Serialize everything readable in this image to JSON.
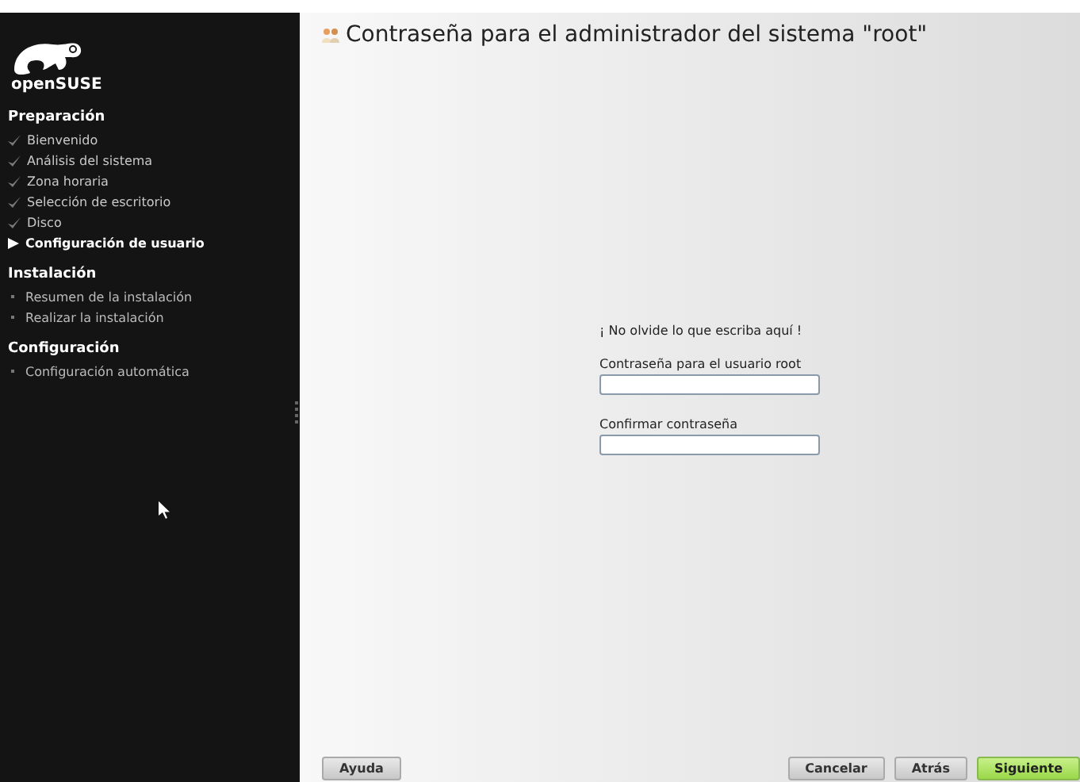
{
  "sidebar": {
    "logo_text": "openSUSE",
    "sections": [
      {
        "title": "Preparación",
        "items": [
          {
            "label": "Bienvenido",
            "kind": "done"
          },
          {
            "label": "Análisis del sistema",
            "kind": "done"
          },
          {
            "label": "Zona horaria",
            "kind": "done"
          },
          {
            "label": "Selección de escritorio",
            "kind": "done"
          },
          {
            "label": "Disco",
            "kind": "done"
          },
          {
            "label": "Configuración de usuario",
            "kind": "current"
          }
        ]
      },
      {
        "title": "Instalación",
        "items": [
          {
            "label": "Resumen de la instalación",
            "kind": "pending"
          },
          {
            "label": "Realizar la instalación",
            "kind": "pending"
          }
        ]
      },
      {
        "title": "Configuración",
        "items": [
          {
            "label": "Configuración automática",
            "kind": "pending"
          }
        ]
      }
    ]
  },
  "page": {
    "title": "Contraseña para el administrador del sistema \"root\"",
    "note": "¡ No olvide lo que escriba aquí !",
    "fields": [
      {
        "label": "Contraseña para el usuario root"
      },
      {
        "label": "Confirmar contraseña"
      }
    ]
  },
  "buttons": [
    {
      "label": "Ayuda",
      "kind": "left"
    },
    {
      "label": "Cancelar",
      "kind": "normal"
    },
    {
      "label": "Atrás",
      "kind": "normal"
    },
    {
      "label": "Siguiente",
      "kind": "default"
    }
  ]
}
